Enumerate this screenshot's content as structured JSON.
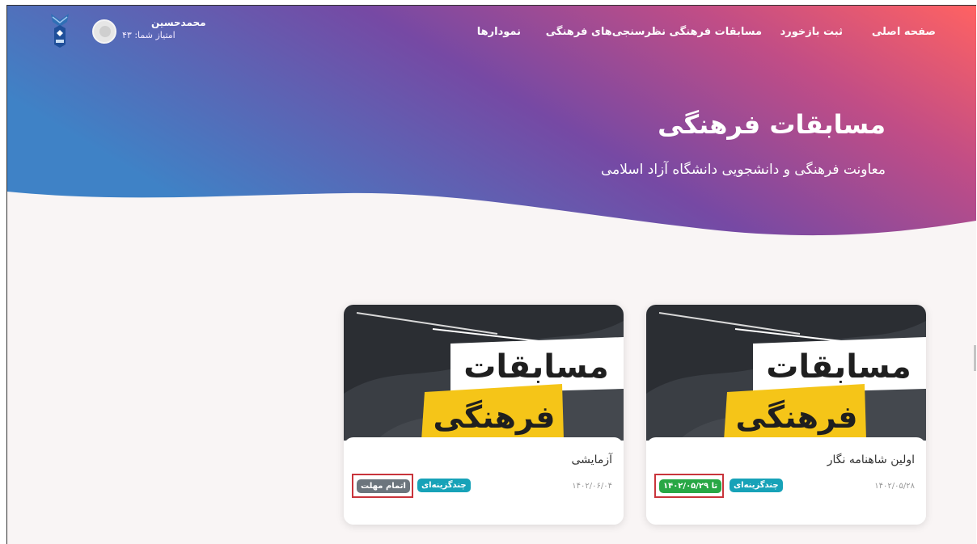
{
  "nav": {
    "items": [
      "صفحه اصلی",
      "ثبت بازخورد",
      "مسابقات فرهنگی",
      "نظرسنجی‌های فرهنگی",
      "نمودارها"
    ]
  },
  "user": {
    "name": "محمدحسین",
    "score": "امتیاز شما: ۴۳"
  },
  "hero": {
    "title": "مسابقات فرهنگی",
    "subtitle": "معاونت فرهنگی و دانشجویی دانشگاه آزاد اسلامی"
  },
  "cards": [
    {
      "image_line1": "مسابقات",
      "image_line2": "فرهنگی",
      "title": "اولین شاهنامه نگار",
      "date": "۱۴۰۲/۰۵/۲۸",
      "type_badge": "چندگزینه‌ای",
      "status_badge": "تا ۱۴۰۲/۰۵/۲۹"
    },
    {
      "image_line1": "مسابقات",
      "image_line2": "فرهنگی",
      "title": "آزمایشی",
      "date": "۱۴۰۲/۰۶/۰۴",
      "type_badge": "چندگزینه‌ای",
      "status_badge": "اتمام مهلت"
    }
  ],
  "colors": {
    "gradient_left": "#3f7fc0",
    "gradient_mid": "#7a4aa6",
    "gradient_right": "#ff6262",
    "badge_type": "#17a2b8",
    "badge_open": "#28a745",
    "badge_closed": "#6c757d",
    "highlight_box": "#c9343b"
  }
}
